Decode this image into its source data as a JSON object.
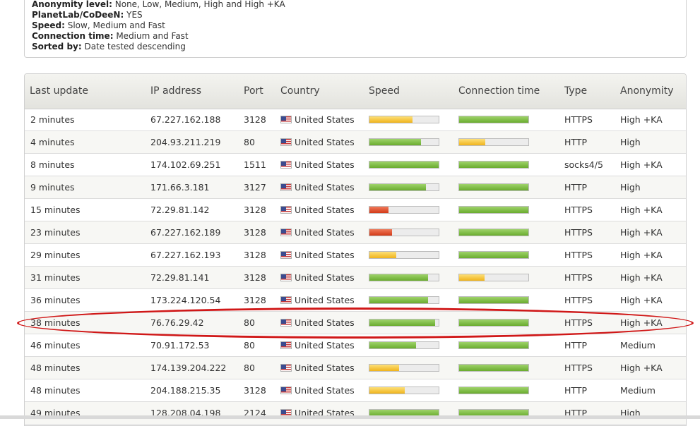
{
  "filters": {
    "anonymity": {
      "label": "Anonymity level:",
      "value": "None, Low, Medium, High and High +KA"
    },
    "planetlab": {
      "label": "PlanetLab/CoDeeN:",
      "value": "YES"
    },
    "speed": {
      "label": "Speed:",
      "value": "Slow, Medium and Fast"
    },
    "connection": {
      "label": "Connection time:",
      "value": "Medium and Fast"
    },
    "sorted": {
      "label": "Sorted by:",
      "value": "Date tested descending"
    }
  },
  "table": {
    "headers": {
      "last_update": "Last update",
      "ip": "IP address",
      "port": "Port",
      "country": "Country",
      "speed": "Speed",
      "connection": "Connection time",
      "type": "Type",
      "anonymity": "Anonymity"
    },
    "rows": [
      {
        "last": "2 minutes",
        "ip": "67.227.162.188",
        "port": "3128",
        "country": "United States",
        "speed": 0.62,
        "speed_color": "yellow",
        "conn": 1.0,
        "conn_color": "green",
        "type": "HTTPS",
        "anon": "High +KA"
      },
      {
        "last": "4 minutes",
        "ip": "204.93.211.219",
        "port": "80",
        "country": "United States",
        "speed": 0.74,
        "speed_color": "green",
        "conn": 0.38,
        "conn_color": "yellow",
        "type": "HTTP",
        "anon": "High"
      },
      {
        "last": "8 minutes",
        "ip": "174.102.69.251",
        "port": "1511",
        "country": "United States",
        "speed": 1.0,
        "speed_color": "green",
        "conn": 1.0,
        "conn_color": "green",
        "type": "socks4/5",
        "anon": "High +KA"
      },
      {
        "last": "9 minutes",
        "ip": "171.66.3.181",
        "port": "3127",
        "country": "United States",
        "speed": 0.82,
        "speed_color": "green",
        "conn": 1.0,
        "conn_color": "green",
        "type": "HTTP",
        "anon": "High"
      },
      {
        "last": "15 minutes",
        "ip": "72.29.81.142",
        "port": "3128",
        "country": "United States",
        "speed": 0.28,
        "speed_color": "red",
        "conn": 1.0,
        "conn_color": "green",
        "type": "HTTPS",
        "anon": "High +KA"
      },
      {
        "last": "23 minutes",
        "ip": "67.227.162.189",
        "port": "3128",
        "country": "United States",
        "speed": 0.33,
        "speed_color": "red",
        "conn": 1.0,
        "conn_color": "green",
        "type": "HTTPS",
        "anon": "High +KA"
      },
      {
        "last": "29 minutes",
        "ip": "67.227.162.193",
        "port": "3128",
        "country": "United States",
        "speed": 0.39,
        "speed_color": "yellow",
        "conn": 1.0,
        "conn_color": "green",
        "type": "HTTPS",
        "anon": "High +KA"
      },
      {
        "last": "31 minutes",
        "ip": "72.29.81.141",
        "port": "3128",
        "country": "United States",
        "speed": 0.85,
        "speed_color": "green",
        "conn": 0.37,
        "conn_color": "yellow",
        "type": "HTTPS",
        "anon": "High +KA"
      },
      {
        "last": "36 minutes",
        "ip": "173.224.120.54",
        "port": "3128",
        "country": "United States",
        "speed": 0.85,
        "speed_color": "green",
        "conn": 1.0,
        "conn_color": "green",
        "type": "HTTPS",
        "anon": "High +KA"
      },
      {
        "last": "38 minutes",
        "ip": "76.76.29.42",
        "port": "80",
        "country": "United States",
        "speed": 0.95,
        "speed_color": "green",
        "conn": 1.0,
        "conn_color": "green",
        "type": "HTTPS",
        "anon": "High +KA"
      },
      {
        "last": "46 minutes",
        "ip": "70.91.172.53",
        "port": "80",
        "country": "United States",
        "speed": 0.67,
        "speed_color": "green",
        "conn": 1.0,
        "conn_color": "green",
        "type": "HTTP",
        "anon": "Medium"
      },
      {
        "last": "48 minutes",
        "ip": "174.139.204.222",
        "port": "80",
        "country": "United States",
        "speed": 0.43,
        "speed_color": "yellow",
        "conn": 1.0,
        "conn_color": "green",
        "type": "HTTPS",
        "anon": "High +KA"
      },
      {
        "last": "48 minutes",
        "ip": "204.188.215.35",
        "port": "3128",
        "country": "United States",
        "speed": 0.51,
        "speed_color": "yellow",
        "conn": 1.0,
        "conn_color": "green",
        "type": "HTTP",
        "anon": "Medium"
      },
      {
        "last": "49 minutes",
        "ip": "128.208.04.198",
        "port": "2124",
        "country": "United States",
        "speed": 1.0,
        "speed_color": "green",
        "conn": 1.0,
        "conn_color": "green",
        "type": "HTTP",
        "anon": "High"
      }
    ]
  }
}
